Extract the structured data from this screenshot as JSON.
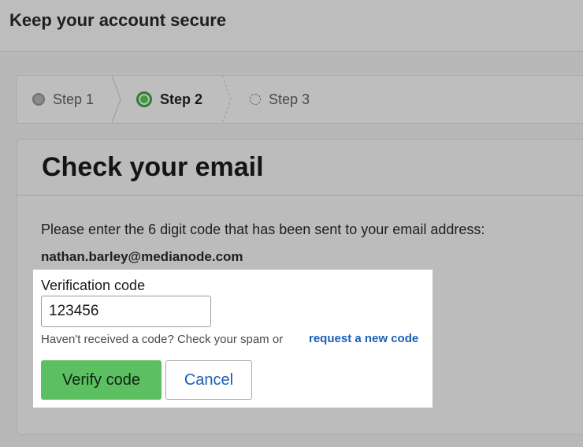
{
  "header": {
    "title": "Keep your account secure"
  },
  "stepper": {
    "steps": [
      {
        "label": "Step 1",
        "state": "completed"
      },
      {
        "label": "Step 2",
        "state": "current"
      },
      {
        "label": "Step 3",
        "state": "upcoming"
      }
    ]
  },
  "card": {
    "title": "Check your email",
    "instructions": "Please enter the 6 digit code that has been sent to your email address:",
    "email": "nathan.barley@medianode.com"
  },
  "form": {
    "code_label": "Verification code",
    "code_value": "123456",
    "hint_text": "Haven't received a code? Check your spam or",
    "hint_link": "request a new code",
    "verify_label": "Verify code",
    "cancel_label": "Cancel"
  },
  "colors": {
    "current_step": "#3d9a41",
    "primary_button": "#5cbf62",
    "link": "#1a5fb4"
  }
}
